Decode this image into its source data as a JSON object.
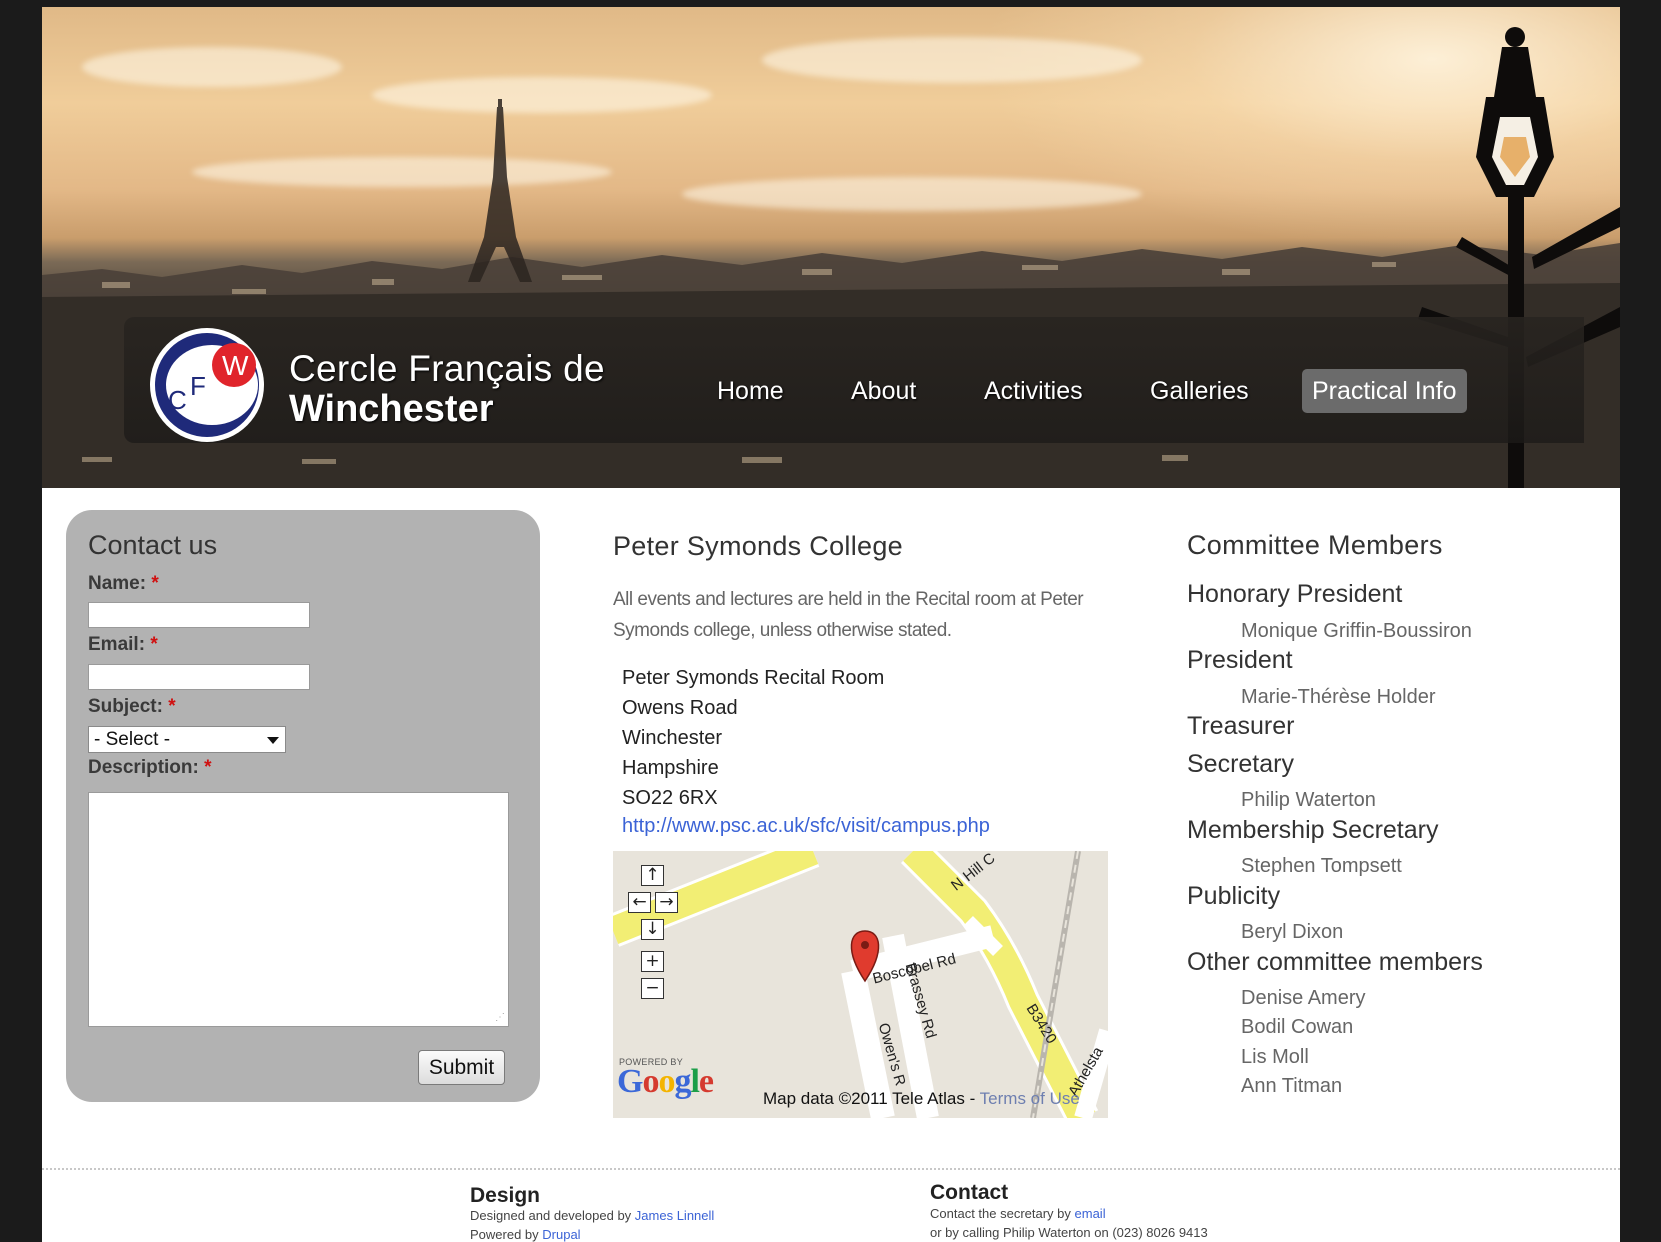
{
  "site": {
    "logo_letters": {
      "c": "C",
      "f": "F",
      "w": "W"
    },
    "name_line1": "Cercle Français de",
    "name_line2": "Winchester"
  },
  "menu": {
    "items": [
      {
        "label": "Home",
        "active": false
      },
      {
        "label": "About",
        "active": false
      },
      {
        "label": "Activities",
        "active": false
      },
      {
        "label": "Galleries",
        "active": false
      },
      {
        "label": "Practical Info",
        "active": true
      }
    ]
  },
  "contact_form": {
    "title": "Contact us",
    "name_label": "Name:",
    "email_label": "Email:",
    "subject_label": "Subject:",
    "description_label": "Description:",
    "required_marker": "*",
    "name_value": "",
    "email_value": "",
    "subject_selected": "- Select -",
    "description_value": "",
    "submit_label": "Submit"
  },
  "venue": {
    "title": "Peter Symonds College",
    "description": "All events and lectures are held in the Recital room at Peter Symonds college, unless otherwise stated.",
    "address": [
      "Peter Symonds Recital Room",
      "Owens Road",
      "Winchester",
      "Hampshire",
      "SO22 6RX"
    ],
    "link": "http://www.psc.ac.uk/sfc/visit/campus.php"
  },
  "map": {
    "controls": {
      "up": "↑",
      "left": "←",
      "right": "→",
      "down": "↓",
      "zoom_in": "+",
      "zoom_out": "−"
    },
    "streets": {
      "n_hill": "N Hill C",
      "boscobel": "Boscobel Rd",
      "brassey": "Brassey Rd",
      "owens": "Owen's R",
      "b3420": "B3420",
      "athelstan": "Athelsta"
    },
    "powered_by": "POWERED BY",
    "google_logo": [
      "G",
      "o",
      "o",
      "g",
      "l",
      "e"
    ],
    "google_colors": [
      "#3b68d8",
      "#d53a2f",
      "#f4b400",
      "#3b68d8",
      "#1c9e49",
      "#d53a2f"
    ],
    "attribution": "Map data ©2011 Tele Atlas - ",
    "terms": "Terms of Use"
  },
  "committee": {
    "title": "Committee Members",
    "roles": [
      {
        "role": "Honorary President",
        "members": [
          "Monique Griffin-Boussiron"
        ]
      },
      {
        "role": "President",
        "members": [
          "Marie-Thérèse Holder"
        ]
      },
      {
        "role": "Treasurer",
        "members": []
      },
      {
        "role": "Secretary",
        "members": [
          "Philip Waterton"
        ]
      },
      {
        "role": "Membership Secretary",
        "members": [
          "Stephen Tompsett"
        ]
      },
      {
        "role": "Publicity",
        "members": [
          "Beryl Dixon"
        ]
      },
      {
        "role": "Other committee members",
        "members": [
          "Denise Amery",
          "Bodil Cowan",
          "Lis Moll",
          "Ann Titman"
        ]
      }
    ]
  },
  "footer": {
    "design_heading": "Design",
    "design_text": "Designed and developed by ",
    "design_link": "James Linnell",
    "powered_text": "Powered by ",
    "powered_link": "Drupal",
    "contact_heading": "Contact",
    "contact_text": "Contact the secretary by ",
    "contact_link": "email",
    "phone_text": "or by calling Philip Waterton on (023) 8026 9413"
  },
  "colors": {
    "accent_link": "#3b63d6",
    "required": "#d01010",
    "panel": "#b2b2b2",
    "active_menu": "#6b6b6b",
    "logo_red": "#e0242b",
    "logo_navy": "#1f2a7a"
  }
}
